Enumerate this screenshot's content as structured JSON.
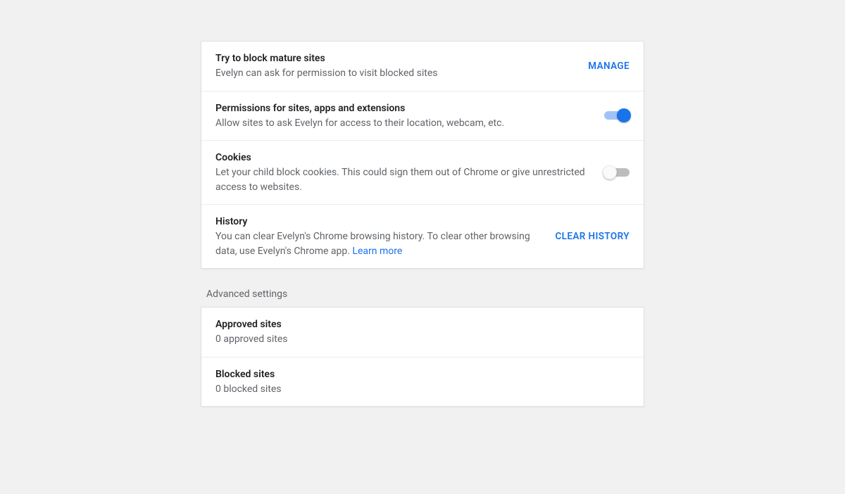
{
  "main": {
    "rows": [
      {
        "title": "Try to block mature sites",
        "subtitle": "Evelyn can ask for permission to visit blocked sites",
        "action": "MANAGE"
      },
      {
        "title": "Permissions for sites, apps and extensions",
        "subtitle": "Allow sites to ask Evelyn for access to their location, webcam, etc.",
        "toggle": true
      },
      {
        "title": "Cookies",
        "subtitle": "Let your child block cookies. This could sign them out of Chrome or give unrestricted access to websites.",
        "toggle": false
      },
      {
        "title": "History",
        "subtitle_prefix": "You can clear Evelyn's Chrome browsing history. To clear other browsing data, use Evelyn's Chrome app. ",
        "learn_more": "Learn more",
        "action": "CLEAR HISTORY"
      }
    ]
  },
  "advanced": {
    "label": "Advanced settings",
    "rows": [
      {
        "title": "Approved sites",
        "subtitle": "0 approved sites"
      },
      {
        "title": "Blocked sites",
        "subtitle": "0 blocked sites"
      }
    ]
  }
}
